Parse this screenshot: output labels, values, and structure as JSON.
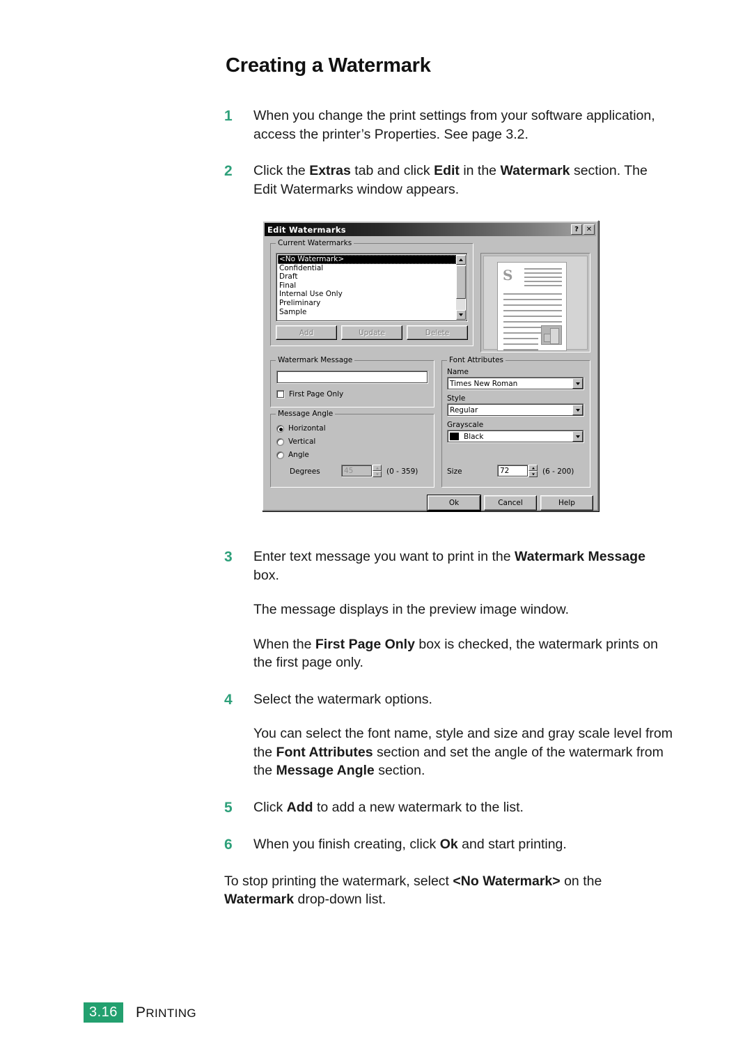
{
  "page": {
    "title": "Creating a Watermark",
    "footer": {
      "folio": "3.16",
      "section_first": "P",
      "section_rest": "RINTING"
    }
  },
  "steps": [
    {
      "num": "1",
      "paras": [
        {
          "runs": [
            {
              "t": "When you change the print settings from your software application, access the printer’s Properties. See page 3.2.",
              "b": false
            }
          ]
        }
      ]
    },
    {
      "num": "2",
      "paras": [
        {
          "runs": [
            {
              "t": "Click the ",
              "b": false
            },
            {
              "t": "Extras",
              "b": true
            },
            {
              "t": " tab and click ",
              "b": false
            },
            {
              "t": "Edit",
              "b": true
            },
            {
              "t": " in the ",
              "b": false
            },
            {
              "t": "Watermark",
              "b": true
            },
            {
              "t": " section. The Edit Watermarks window appears.",
              "b": false
            }
          ]
        }
      ]
    },
    {
      "num": "3",
      "paras": [
        {
          "runs": [
            {
              "t": "Enter text message you want to print in the ",
              "b": false
            },
            {
              "t": "Watermark Message",
              "b": true
            },
            {
              "t": " box.",
              "b": false
            }
          ]
        },
        {
          "runs": [
            {
              "t": "The message displays in the preview image window.",
              "b": false
            }
          ]
        },
        {
          "runs": [
            {
              "t": "When the ",
              "b": false
            },
            {
              "t": "First Page Only",
              "b": true
            },
            {
              "t": " box is checked, the watermark prints on the first page only.",
              "b": false
            }
          ]
        }
      ]
    },
    {
      "num": "4",
      "paras": [
        {
          "runs": [
            {
              "t": "Select the watermark options.",
              "b": false
            }
          ]
        },
        {
          "runs": [
            {
              "t": "You can select the font name, style and size and gray scale level from the ",
              "b": false
            },
            {
              "t": "Font Attributes",
              "b": true
            },
            {
              "t": " section and set the angle of the watermark from the ",
              "b": false
            },
            {
              "t": "Message Angle",
              "b": true
            },
            {
              "t": " section.",
              "b": false
            }
          ]
        }
      ]
    },
    {
      "num": "5",
      "paras": [
        {
          "runs": [
            {
              "t": "Click ",
              "b": false
            },
            {
              "t": "Add",
              "b": true
            },
            {
              "t": " to add a new watermark to the list.",
              "b": false
            }
          ]
        }
      ]
    },
    {
      "num": "6",
      "paras": [
        {
          "runs": [
            {
              "t": "When you finish creating, click ",
              "b": false
            },
            {
              "t": "Ok",
              "b": true
            },
            {
              "t": " and start printing.",
              "b": false
            }
          ]
        }
      ]
    }
  ],
  "closing": {
    "runs": [
      {
        "t": "To stop printing the watermark, select ",
        "b": false
      },
      {
        "t": "<No Watermark>",
        "b": true
      },
      {
        "t": " on the ",
        "b": false
      },
      {
        "t": "Watermark",
        "b": true
      },
      {
        "t": " drop-down list.",
        "b": false
      }
    ]
  },
  "dialog": {
    "title": "Edit Watermarks",
    "titlebar_buttons": [
      {
        "name": "help-titlebar-button",
        "label": "?"
      },
      {
        "name": "close-titlebar-button",
        "label": "✕"
      }
    ],
    "current_watermarks": {
      "legend": "Current Watermarks",
      "items": [
        "<No Watermark>",
        "Confidential",
        "Draft",
        "Final",
        "Internal Use Only",
        "Preliminary",
        "Sample"
      ],
      "selected_index": 0,
      "buttons": [
        {
          "label": "Add",
          "enabled": false
        },
        {
          "label": "Update",
          "enabled": false
        },
        {
          "label": "Delete",
          "enabled": false
        }
      ]
    },
    "watermark_message": {
      "legend": "Watermark Message",
      "value": "",
      "first_page_only": {
        "label": "First Page Only",
        "checked": false
      }
    },
    "message_angle": {
      "legend": "Message Angle",
      "options": [
        {
          "label": "Horizontal",
          "selected": true
        },
        {
          "label": "Vertical",
          "selected": false
        },
        {
          "label": "Angle",
          "selected": false
        }
      ],
      "degrees_label": "Degrees",
      "degrees_value": "45",
      "degrees_range": "(0 - 359)",
      "degrees_enabled": false
    },
    "font_attributes": {
      "legend": "Font Attributes",
      "name_label": "Name",
      "name_value": "Times New Roman",
      "style_label": "Style",
      "style_value": "Regular",
      "grayscale_label": "Grayscale",
      "grayscale_value": "Black",
      "grayscale_swatch": "#000000",
      "size_label": "Size",
      "size_value": "72",
      "size_range": "(6 - 200)"
    },
    "action_buttons": [
      {
        "label": "Ok",
        "default": true
      },
      {
        "label": "Cancel",
        "default": false
      },
      {
        "label": "Help",
        "default": false
      }
    ]
  },
  "theme": {
    "accent_green": "#2ea07a",
    "folio_green": "#23a06f",
    "dialog_face": "#c0c0c0"
  }
}
